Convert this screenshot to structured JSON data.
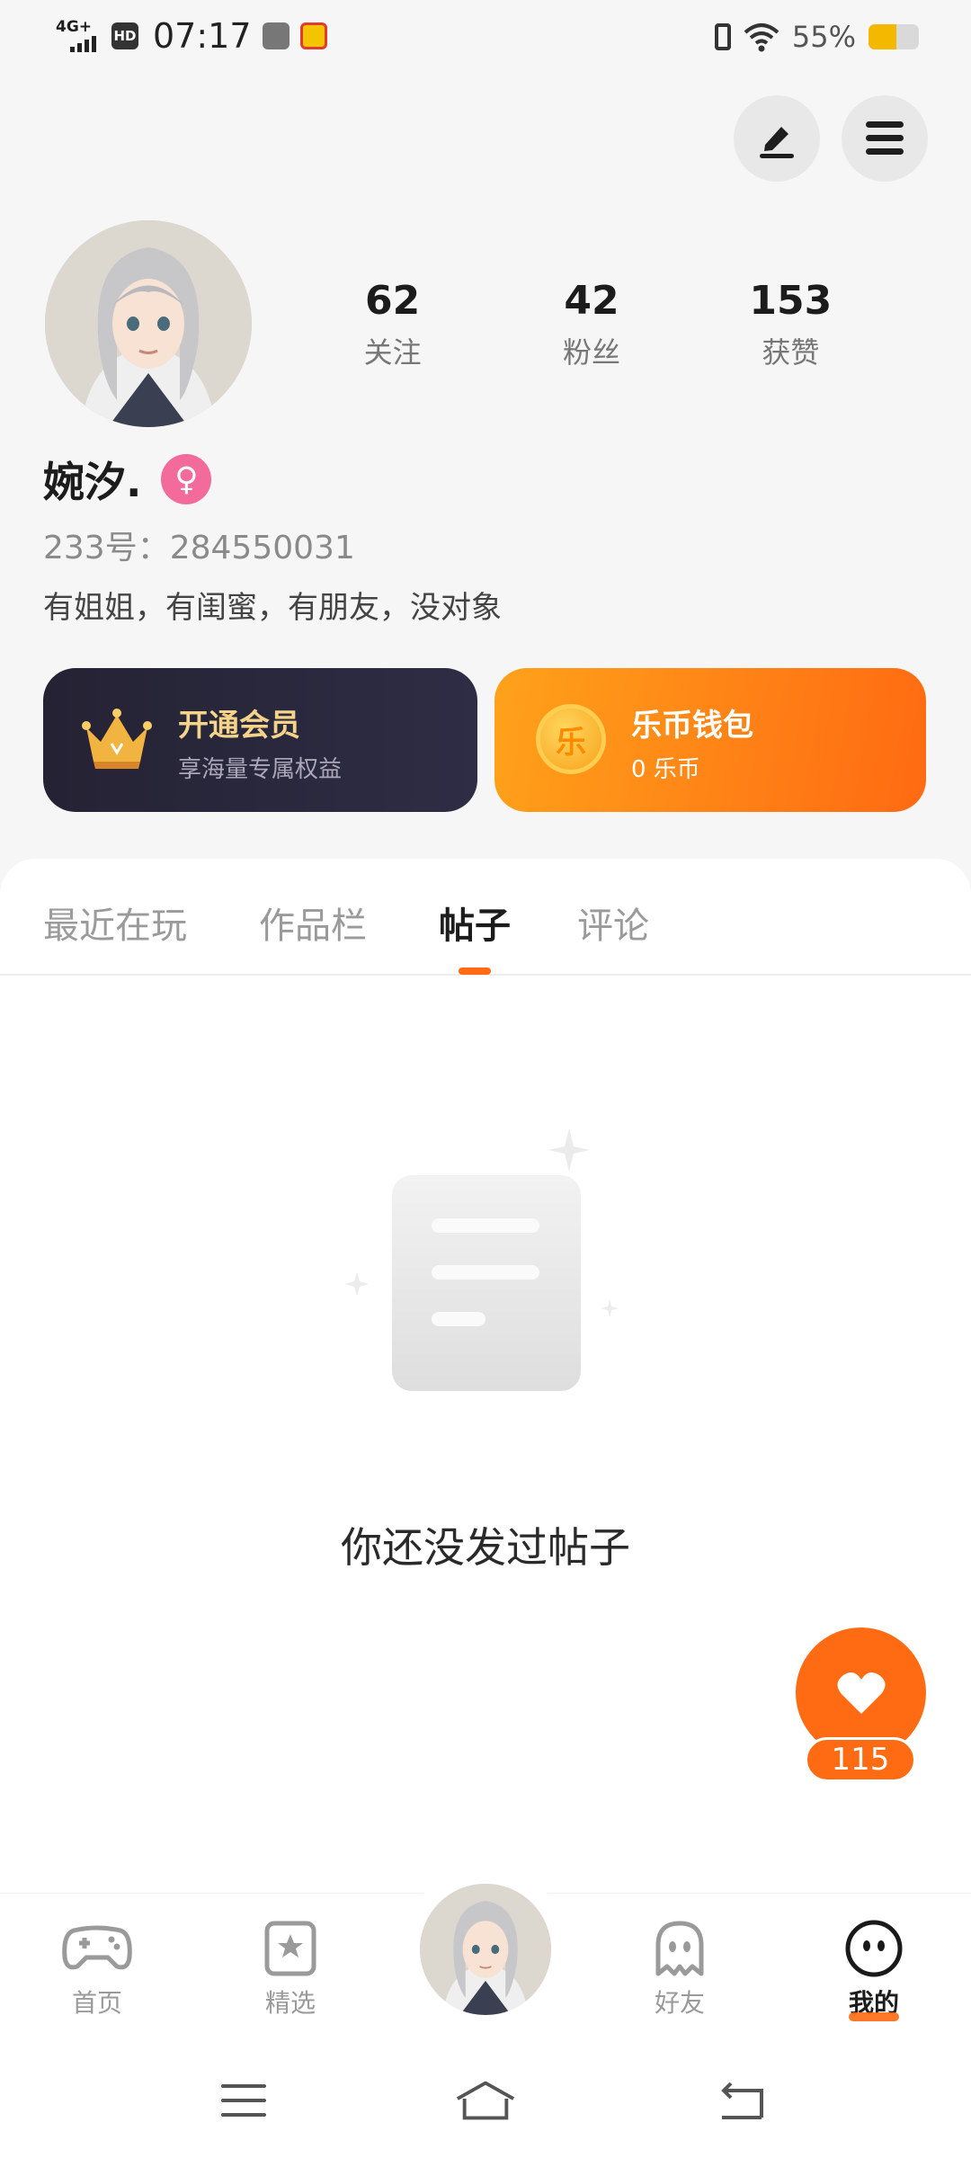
{
  "status_bar": {
    "network": "4G+",
    "hd": "HD",
    "time": "07:17",
    "battery_percent": "55%",
    "battery_level": 0.55
  },
  "profile": {
    "username": "婉汐.",
    "gender_symbol": "♀",
    "user_id": "233号：284550031",
    "bio": "有姐姐，有闺蜜，有朋友，没对象",
    "stats": [
      {
        "value": "62",
        "label": "关注"
      },
      {
        "value": "42",
        "label": "粉丝"
      },
      {
        "value": "153",
        "label": "获赞"
      }
    ]
  },
  "cards": {
    "vip": {
      "title": "开通会员",
      "subtitle": "享海量专属权益"
    },
    "wallet": {
      "title": "乐币钱包",
      "subtitle": "0 乐币",
      "coin_char": "乐"
    }
  },
  "tabs": [
    {
      "label": "最近在玩",
      "active": false
    },
    {
      "label": "作品栏",
      "active": false
    },
    {
      "label": "帖子",
      "active": true
    },
    {
      "label": "评论",
      "active": false
    }
  ],
  "empty_state": {
    "message": "你还没发过帖子"
  },
  "like_button": {
    "count": "115"
  },
  "bottom_nav": [
    {
      "label": "首页",
      "icon": "gamepad-icon",
      "active": false
    },
    {
      "label": "精选",
      "icon": "star-bookmark-icon",
      "active": false
    },
    {
      "label": "",
      "icon": "avatar",
      "active": false
    },
    {
      "label": "好友",
      "icon": "ghost-icon",
      "active": false
    },
    {
      "label": "我的",
      "icon": "smiley-icon",
      "active": true
    }
  ],
  "colors": {
    "accent": "#ff6a12",
    "vip_gold": "#f5d48a",
    "vip_bg": "#2a2838",
    "gender_pink": "#f36b9b"
  }
}
